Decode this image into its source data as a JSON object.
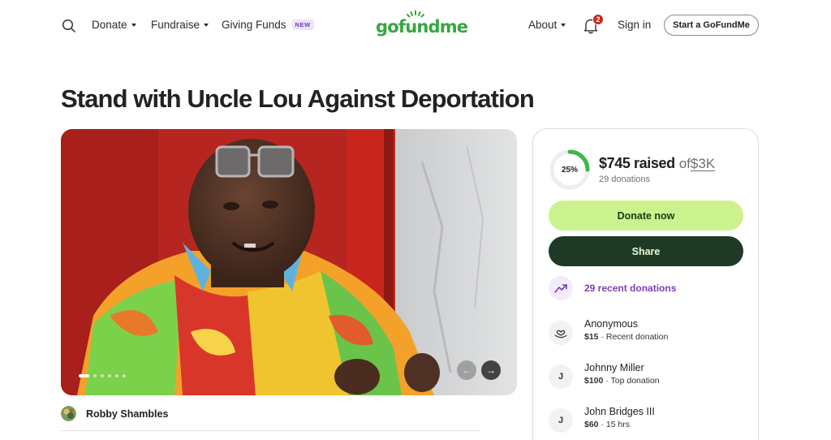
{
  "header": {
    "nav": [
      {
        "label": "Donate",
        "has_menu": true
      },
      {
        "label": "Fundraise",
        "has_menu": true
      },
      {
        "label": "Giving Funds",
        "badge": "NEW"
      }
    ],
    "logo_text": "gofundme",
    "about": "About",
    "notification_count": "2",
    "sign_in": "Sign in",
    "start_cta": "Start a GoFundMe"
  },
  "campaign": {
    "title": "Stand with Uncle Lou Against Deportation",
    "organizer": "Robby Shambles",
    "gallery": {
      "slides": 6,
      "active": 1
    }
  },
  "donation_card": {
    "percent": "25%",
    "progress": 0.25,
    "raised": "$745 raised",
    "of": "of",
    "goal": "$3K",
    "donation_count": "29 donations",
    "donate_label": "Donate now",
    "share_label": "Share",
    "recent_label": "29 recent donations",
    "donors": [
      {
        "name": "Anonymous",
        "amount": "$15",
        "detail": "· Recent donation",
        "icon": "heart-hand-icon"
      },
      {
        "name": "Johnny Miller",
        "amount": "$100",
        "detail": "· Top donation",
        "initial": "J"
      },
      {
        "name": "John Bridges III",
        "amount": "$60",
        "detail": "· 15 hrs",
        "initial": "J"
      }
    ]
  },
  "colors": {
    "brand_green": "#37a63f",
    "donate_bg": "#cbf28d",
    "share_bg": "#1e3a27",
    "recent_purple": "#7b3fb4",
    "badge_red": "#c7271c"
  }
}
